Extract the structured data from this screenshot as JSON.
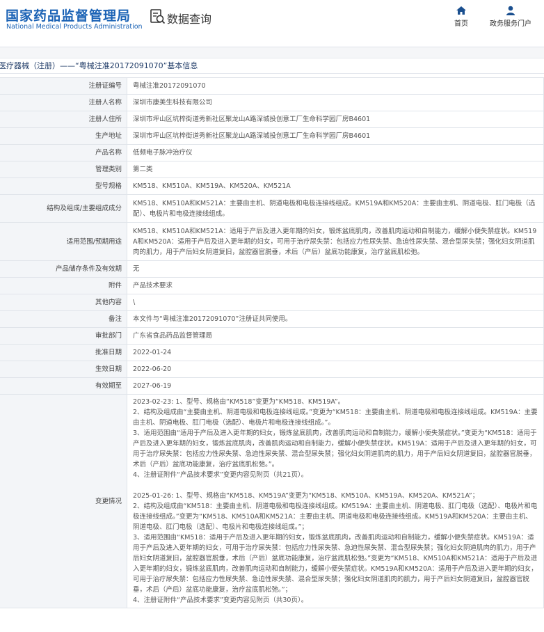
{
  "header": {
    "logo_cn": "国家药品监督管理局",
    "logo_en": "National Medical Products Administration",
    "query_title": "数据查询",
    "nav_home": "首页",
    "nav_gov": "政务服务门户"
  },
  "breadcrumb": "医疗器械（注册）——“粤械注准20172091070”基本信息",
  "rows": [
    {
      "label": "注册证编号",
      "value": "粤械注准20172091070"
    },
    {
      "label": "注册人名称",
      "value": "深圳市康美生科技有限公司"
    },
    {
      "label": "注册人住所",
      "value": "深圳市坪山区坑梓街道秀新社区聚龙山A路深城投创意工厂生命科学园厂房B4601"
    },
    {
      "label": "生产地址",
      "value": "深圳市坪山区坑梓街道秀新社区聚龙山A路深城投创意工厂生命科学园厂房B4601"
    },
    {
      "label": "产品名称",
      "value": "低频电子脉冲治疗仪"
    },
    {
      "label": "管理类别",
      "value": "第二类"
    },
    {
      "label": "型号规格",
      "value": "KM518、KM510A、KM519A、KM520A、KM521A"
    },
    {
      "label": "结构及组成/主要组成成分",
      "value": "KM518、KM510A和KM521A：主要由主机、阴道电极和电极连接线组成。KM519A和KM520A：主要由主机、阴道电极、肛门电极（选配）、电极片和电极连接线组成。"
    },
    {
      "label": "适用范围/预期用途",
      "value": "KM518、KM510A和KM521A：适用于产后及进入更年期的妇女，锻炼盆底肌肉，改善肌肉运动和自制能力，缓解小便失禁症状。KM519A和KM520A：适用于产后及进入更年期的妇女，可用于治疗尿失禁：包括应力性尿失禁、急迫性尿失禁、混合型尿失禁；强化妇女阴道肌肉的肌力，用于产后妇女阴道复旧，盆腔器官脱垂，术后（产后）盆底功能康复，治疗盆底肌松弛。"
    },
    {
      "label": "产品储存条件及有效期",
      "value": "无"
    },
    {
      "label": "附件",
      "value": "产品技术要求"
    },
    {
      "label": "其他内容",
      "value": "\\"
    },
    {
      "label": "备注",
      "value": "本文件与“粤械注准20172091070”注册证共同使用。"
    },
    {
      "label": "审批部门",
      "value": "广东省食品药品监督管理局"
    },
    {
      "label": "批准日期",
      "value": "2022-01-24"
    },
    {
      "label": "生效日期",
      "value": "2022-06-20"
    },
    {
      "label": "有效期至",
      "value": "2027-06-19"
    }
  ],
  "changes": {
    "label": "变更情况",
    "block1": [
      "2023-02-23: 1、型号、规格由“KM518”变更为“KM518、KM519A”。",
      "2、结构及组成由“主要由主机、阴道电极和电极连接线组成。”变更为“KM518：主要由主机、阴道电极和电极连接线组成。KM519A：主要由主机、阴道电极、肛门电极（选配）、电极片和电极连接线组成。”。",
      "3、适用范围由“适用于产后及进入更年期的妇女，锻炼盆底肌肉，改善肌肉运动和自制能力，缓解小便失禁症状。”变更为“KM518：适用于产后及进入更年期的妇女，锻炼盆底肌肉，改善肌肉运动和自制能力，缓解小便失禁症状。KM519A：适用于产后及进入更年期的妇女，可用于治疗尿失禁：包括应力性尿失禁、急迫性尿失禁、混合型尿失禁；强化妇女阴道肌肉的肌力，用于产后妇女阴道复旧，盆腔器官脱垂，术后（产后）盆底功能康复，治疗盆底肌松弛。”。",
      "4、注册证附件“产品技术要求”变更内容见附页（共21页）。"
    ],
    "block2": [
      "2025-01-26: 1、型号、规格由“KM518、KM519A”变更为“KM518、KM510A、KM519A、KM520A、KM521A”；",
      "2、结构及组成由“KM518：主要由主机、阴道电极和电极连接线组成。KM519A：主要由主机、阴道电极、肛门电极（选配）、电极片和电极连接线组成。”变更为“KM518、KM510A和KM521A：主要由主机、阴道电极和电极连接线组成。KM519A和KM520A：主要由主机、阴道电极、肛门电极（选配）、电极片和电极连接线组成。”；",
      "3、适用范围由“KM518：适用于产后及进入更年期的妇女，锻炼盆底肌肉，改善肌肉运动和自制能力，缓解小便失禁症状。KM519A：适用于产后及进入更年期的妇女，可用于治疗尿失禁：包括应力性尿失禁、急迫性尿失禁、混合型尿失禁；强化妇女阴道肌肉的肌力，用于产后妇女阴道复旧，盆腔器官脱垂，术后（产后）盆底功能康复，治疗盆底肌松弛。”变更为“KM518、KM510A和KM521A：适用于产后及进入更年期的妇女，锻炼盆底肌肉，改善肌肉运动和自制能力，缓解小便失禁症状。KM519A和KM520A：适用于产后及进入更年期的妇女，可用于治疗尿失禁：包括应力性尿失禁、急迫性尿失禁、混合型尿失禁；强化妇女阴道肌肉的肌力，用于产后妇女阴道复旧，盆腔器官脱垂，术后（产后）盆底功能康复，治疗盆底肌松弛。”；",
      "4、注册证附件“产品技术要求”变更内容见附页（共30页）。"
    ]
  },
  "colors": {
    "brand": "#1a62b5",
    "nav_icon": "#1a4f8f",
    "label_bg": "#f3f5f8"
  }
}
